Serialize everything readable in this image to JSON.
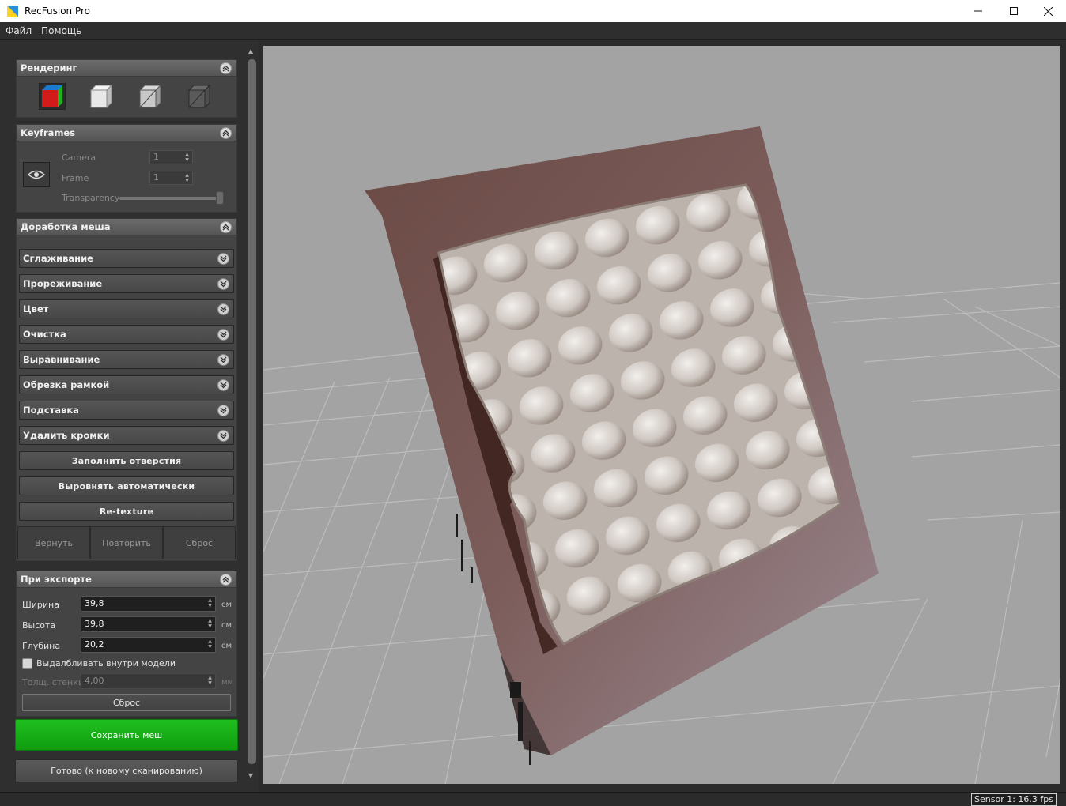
{
  "window": {
    "title": "RecFusion Pro"
  },
  "menu": {
    "items": [
      "Файл",
      "Помощь"
    ]
  },
  "rendering": {
    "title": "Рендеринг",
    "modes": [
      "color-cube-icon",
      "solid-cube-icon",
      "shaded-wire-cube-icon",
      "wireframe-cube-icon"
    ]
  },
  "keyframes": {
    "title": "Keyframes",
    "camera_label": "Camera",
    "camera_value": "1",
    "frame_label": "Frame",
    "frame_value": "1",
    "transparency_label": "Transparency",
    "transparency_level": 1.0
  },
  "mesh": {
    "title": "Доработка меша",
    "subsections": [
      "Сглаживание",
      "Прореживание",
      "Цвет",
      "Очистка",
      "Выравнивание",
      "Обрезка рамкой",
      "Подставка",
      "Удалить кромки"
    ],
    "actions": [
      "Заполнить отверстия",
      "Выровнять автоматически",
      "Re-texture"
    ],
    "undo": "Вернуть",
    "redo": "Повторить",
    "reset": "Сброс"
  },
  "export": {
    "title": "При экспорте",
    "width_label": "Ширина",
    "width_value": "39,8",
    "width_unit": "см",
    "height_label": "Высота",
    "height_value": "39,8",
    "height_unit": "см",
    "depth_label": "Глубина",
    "depth_value": "20,2",
    "depth_unit": "см",
    "hollow_label": "Выдалбливать внутри модели",
    "hollow_checked": false,
    "wall_label": "Толщ. стенки",
    "wall_value": "4,00",
    "wall_unit": "мм",
    "reset": "Сброс"
  },
  "buttons": {
    "save_mesh": "Сохранить меш",
    "done": "Готово (к новому сканированию)"
  },
  "status": {
    "sensor": "Sensor 1: 16.3 fps"
  },
  "colors": {
    "save_green": "#17b117",
    "viewport_bg": "#a3a3a3",
    "panel_bg": "#2f2f2f"
  }
}
